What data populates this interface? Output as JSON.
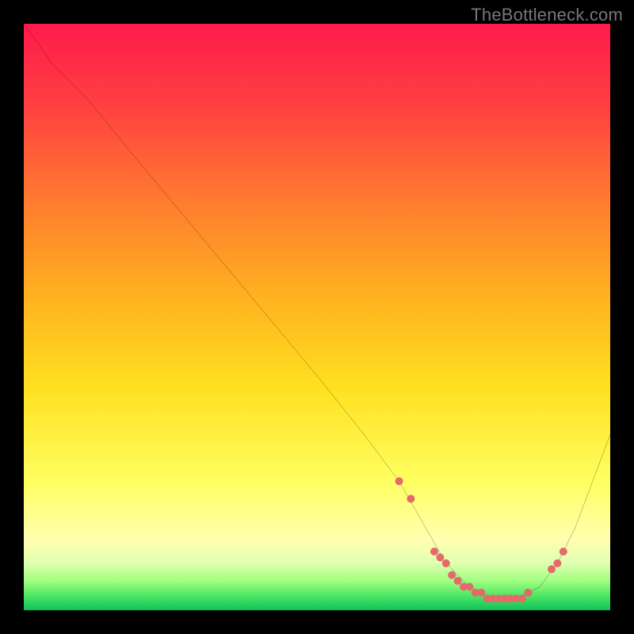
{
  "watermark": "TheBottleneck.com",
  "chart_data": {
    "type": "line",
    "title": "",
    "xlabel": "",
    "ylabel": "",
    "xlim": [
      0,
      100
    ],
    "ylim": [
      0,
      100
    ],
    "yaxis_inverted": false,
    "series": [
      {
        "name": "bottleneck-curve",
        "x": [
          0,
          5,
          11,
          20,
          30,
          40,
          50,
          58,
          64,
          68,
          72,
          76,
          80,
          84,
          88,
          91,
          94,
          100
        ],
        "y": [
          100,
          93,
          87,
          76,
          64,
          52,
          40,
          30,
          22,
          15,
          8,
          4,
          2,
          2,
          4,
          8,
          14,
          30
        ],
        "stroke": "#000000",
        "stroke_width": 1.5
      }
    ],
    "markers": {
      "name": "highlighted-points",
      "color": "#e46a6a",
      "radius": 5,
      "x": [
        64,
        66,
        70,
        71,
        72,
        73,
        74,
        75,
        76,
        77,
        78,
        79,
        80,
        81,
        82,
        83,
        84,
        85,
        86,
        90,
        91,
        92
      ],
      "y": [
        22,
        19,
        10,
        9,
        8,
        6,
        5,
        4,
        4,
        3,
        3,
        2,
        2,
        2,
        2,
        2,
        2,
        2,
        3,
        7,
        8,
        10
      ]
    },
    "background_gradient": {
      "direction": "vertical",
      "stops": [
        {
          "pos": 0.0,
          "color": "#ff1a4d"
        },
        {
          "pos": 0.5,
          "color": "#ffc020"
        },
        {
          "pos": 0.8,
          "color": "#ffff70"
        },
        {
          "pos": 0.95,
          "color": "#90ff80"
        },
        {
          "pos": 1.0,
          "color": "#10c060"
        }
      ]
    }
  }
}
